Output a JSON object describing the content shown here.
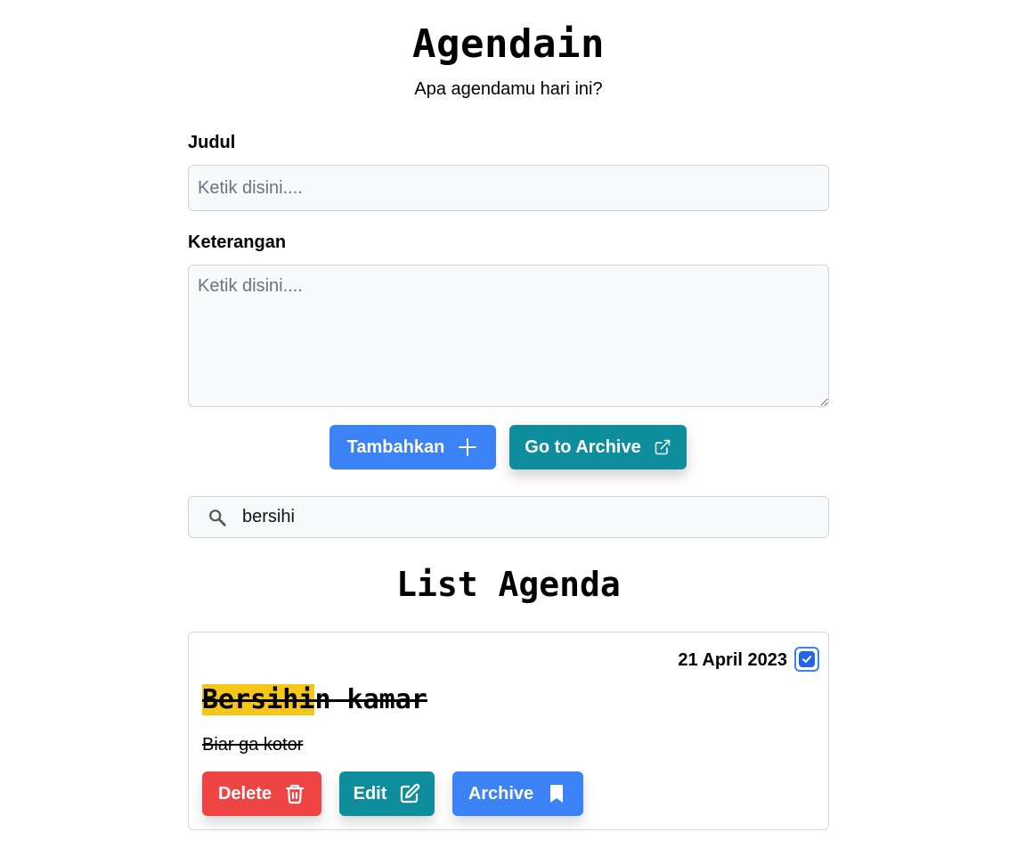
{
  "app": {
    "title": "Agendain",
    "subtitle": "Apa agendamu hari ini?"
  },
  "form": {
    "title_label": "Judul",
    "title_placeholder": "Ketik disini....",
    "title_value": "",
    "desc_label": "Keterangan",
    "desc_placeholder": "Ketik disini....",
    "desc_value": "",
    "add_button": "Tambahkan",
    "add_icon": "plus-icon",
    "archive_link_button": "Go to Archive",
    "archive_link_icon": "external-link-icon"
  },
  "search": {
    "icon": "search-icon",
    "value": "bersihi"
  },
  "list": {
    "title": "List Agenda",
    "items": [
      {
        "date": "21 April 2023",
        "completed": true,
        "title_highlight": "Bersihi",
        "title_rest": "n kamar",
        "description": "Biar ga kotor",
        "delete_label": "Delete",
        "edit_label": "Edit",
        "archive_label": "Archive"
      }
    ]
  },
  "colors": {
    "primary": "#3b82f6",
    "teal": "#0e8e9c",
    "danger": "#ef4444",
    "highlight": "#f5c518"
  }
}
